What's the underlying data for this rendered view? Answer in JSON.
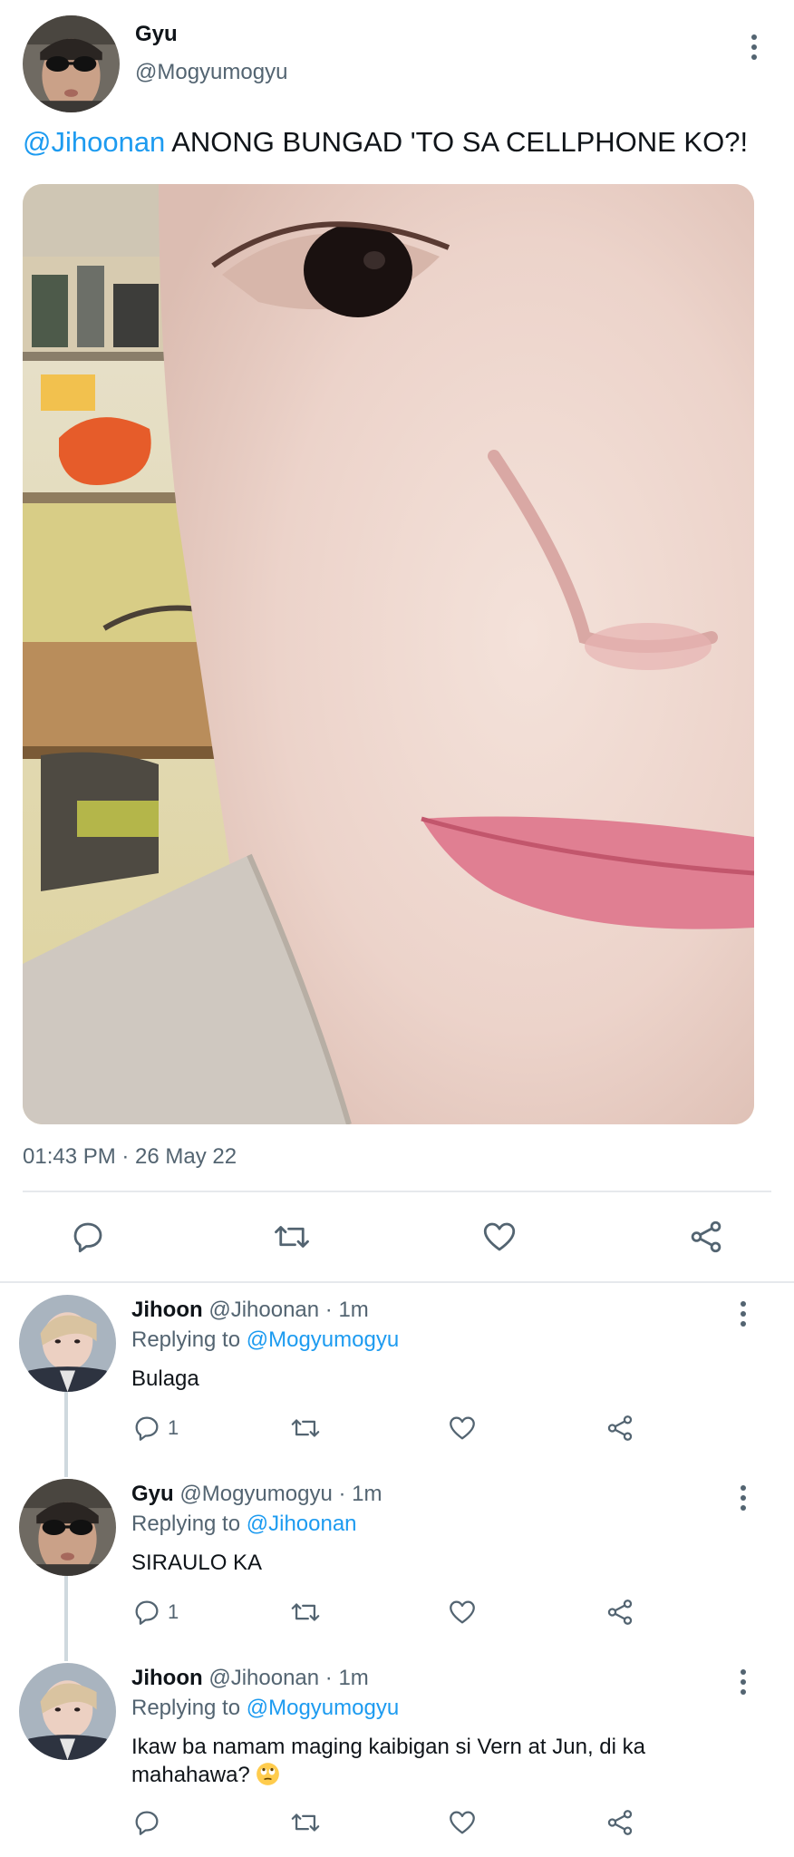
{
  "main_tweet": {
    "author_name": "Gyu",
    "author_handle": "@Mogyumogyu",
    "mention": "@Jihoonan",
    "text": "ANONG BUNGAD 'TO SA CELLPHONE KO?!",
    "timestamp": "01:43 PM · 26 May 22"
  },
  "actions": {
    "reply_icon": "reply-icon",
    "retweet_icon": "retweet-icon",
    "like_icon": "heart-icon",
    "share_icon": "share-icon"
  },
  "replies": [
    {
      "name": "Jihoon",
      "handle_time": "@Jihoonan · 1m",
      "replying_prefix": "Replying to",
      "replying_to": "@Mogyumogyu",
      "text": "Bulaga",
      "reply_count": "1"
    },
    {
      "name": "Gyu",
      "handle_time": "@Mogyumogyu · 1m",
      "replying_prefix": "Replying to",
      "replying_to": "@Jihoonan",
      "text": "SIRAULO KA",
      "reply_count": "1"
    },
    {
      "name": "Jihoon",
      "handle_time": "@Jihoonan · 1m",
      "replying_prefix": "Replying to",
      "replying_to": "@Mogyumogyu",
      "text": "Ikaw ba namam maging kaibigan si Vern at Jun, di ka mahahawa?",
      "reply_count": ""
    }
  ],
  "colors": {
    "accent": "#1d9bf0",
    "muted": "#536471",
    "text": "#0f1419",
    "divider": "#e6e9ec"
  }
}
